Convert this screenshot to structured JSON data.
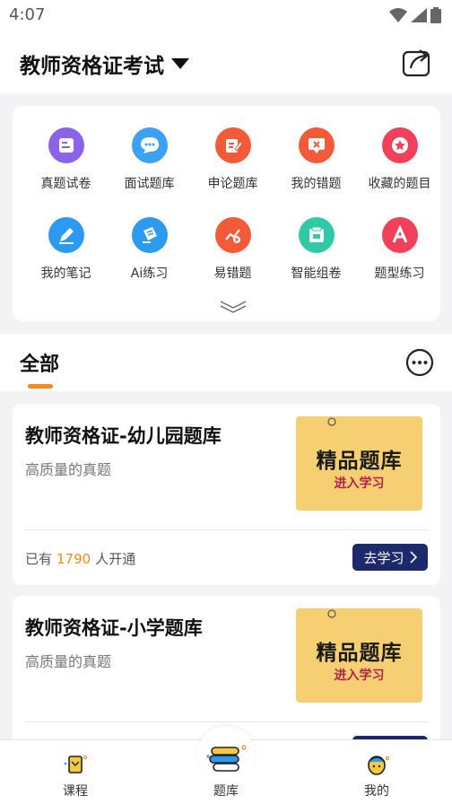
{
  "status": {
    "time": "4:07"
  },
  "header": {
    "title": "教师资格证考试"
  },
  "grid": [
    {
      "label": "真题试卷",
      "icon": "paper-icon",
      "color": "#8a63e8"
    },
    {
      "label": "面试题库",
      "icon": "chat-bubble-icon",
      "color": "#3aa2f0"
    },
    {
      "label": "申论题库",
      "icon": "edit-note-icon",
      "color": "#f25a38"
    },
    {
      "label": "我的错题",
      "icon": "wrong-message-icon",
      "color": "#f25a38"
    },
    {
      "label": "收藏的题目",
      "icon": "star-icon",
      "color": "#f0405a"
    },
    {
      "label": "我的笔记",
      "icon": "pencil-icon",
      "color": "#2c9af0"
    },
    {
      "label": "Ai练习",
      "icon": "ai-practice-icon",
      "color": "#2c9af0"
    },
    {
      "label": "易错题",
      "icon": "error-chart-icon",
      "color": "#f25a38"
    },
    {
      "label": "智能组卷",
      "icon": "smart-paper-icon",
      "color": "#2fc9a8"
    },
    {
      "label": "题型练习",
      "icon": "letter-a-icon",
      "color": "#f0405a"
    }
  ],
  "tabs": {
    "active": "全部"
  },
  "banks": [
    {
      "title": "教师资格证-幼儿园题库",
      "subtitle": "高质量的真题",
      "thumb_main": "精品题库",
      "thumb_sub": "进入学习",
      "footer_prefix": "已有",
      "count": "1790",
      "footer_suffix": "人开通",
      "button": "去学习"
    },
    {
      "title": "教师资格证-小学题库",
      "subtitle": "高质量的真题",
      "thumb_main": "精品题库",
      "thumb_sub": "进入学习"
    }
  ],
  "nav": {
    "course": "课程",
    "bank": "题库",
    "mine": "我的"
  },
  "colors": {
    "accent": "#f08c19",
    "button": "#1c2a6b"
  }
}
